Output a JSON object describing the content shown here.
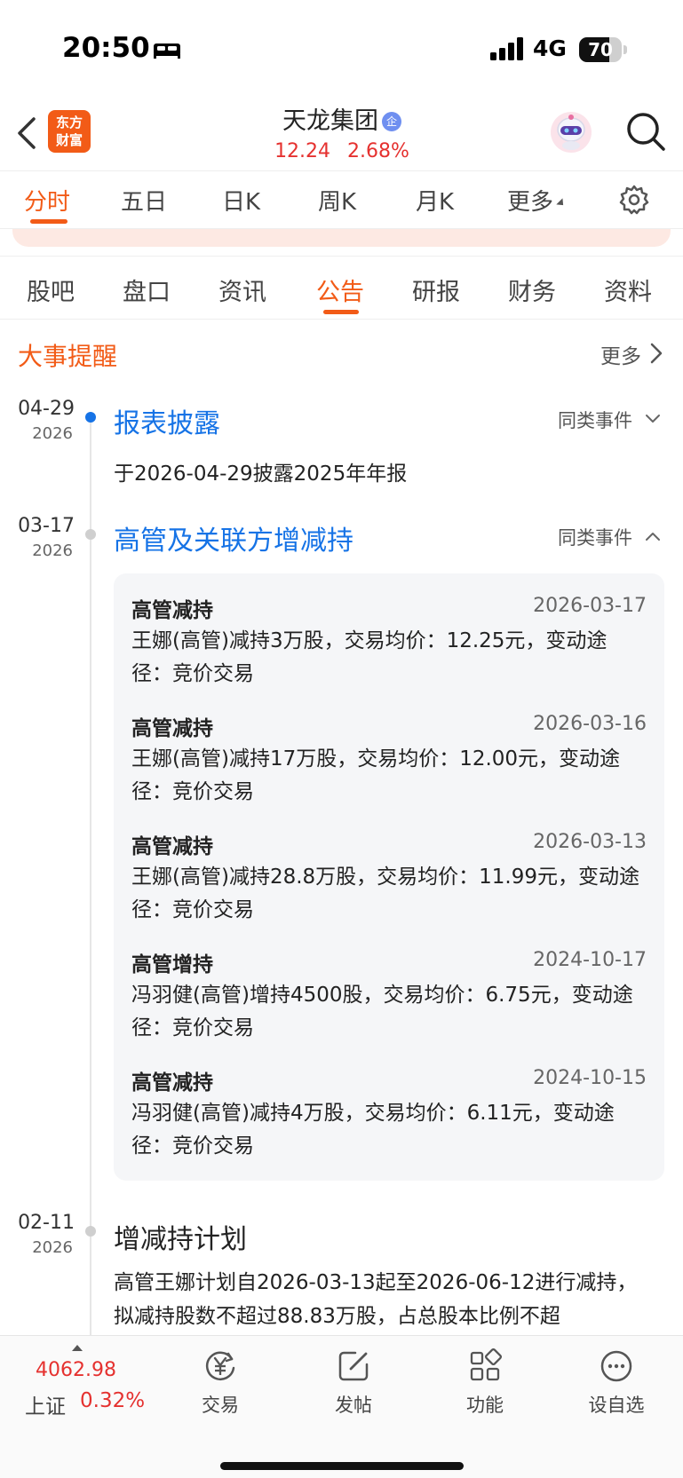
{
  "status_bar": {
    "time": "20:50",
    "network": "4G",
    "battery": "70",
    "battery_level": 0.7
  },
  "header": {
    "logo_text_line1": "东方",
    "logo_text_line2": "财富",
    "stock_name": "天龙集团",
    "badge": "企",
    "price": "12.24",
    "change_pct": "2.68%"
  },
  "chart_tabs": [
    {
      "label": "分时",
      "active": true
    },
    {
      "label": "五日"
    },
    {
      "label": "日K"
    },
    {
      "label": "周K"
    },
    {
      "label": "月K"
    },
    {
      "label": "更多"
    }
  ],
  "content_tabs": [
    {
      "label": "股吧"
    },
    {
      "label": "盘口"
    },
    {
      "label": "资讯"
    },
    {
      "label": "公告",
      "active": true
    },
    {
      "label": "研报"
    },
    {
      "label": "财务"
    },
    {
      "label": "资料"
    }
  ],
  "section": {
    "title": "大事提醒",
    "more": "更多"
  },
  "events": [
    {
      "date": "04-29",
      "year": "2026",
      "title": "报表披露",
      "similar": "同类事件",
      "text": "于2026-04-29披露2025年年报"
    },
    {
      "date": "03-17",
      "year": "2026",
      "title": "高管及关联方增减持",
      "similar": "同类事件",
      "items": [
        {
          "title": "高管减持",
          "date": "2026-03-17",
          "desc": "王娜(高管)减持3万股，交易均价：12.25元，变动途径：竞价交易"
        },
        {
          "title": "高管减持",
          "date": "2026-03-16",
          "desc": "王娜(高管)减持17万股，交易均价：12.00元，变动途径：竞价交易"
        },
        {
          "title": "高管减持",
          "date": "2026-03-13",
          "desc": "王娜(高管)减持28.8万股，交易均价：11.99元，变动途径：竞价交易"
        },
        {
          "title": "高管增持",
          "date": "2024-10-17",
          "desc": "冯羽健(高管)增持4500股，交易均价：6.75元，变动途径：竞价交易"
        },
        {
          "title": "高管减持",
          "date": "2024-10-15",
          "desc": "冯羽健(高管)减持4万股，交易均价：6.11元，变动途径：竞价交易"
        }
      ]
    },
    {
      "date": "02-11",
      "year": "2026",
      "title": "增减持计划",
      "text": "高管王娜计划自2026-03-13起至2026-06-12进行减持，拟减持股数不超过88.83万股，占总股本比例不超"
    }
  ],
  "bottom_bar": {
    "index_value": "4062.98",
    "index_name": "上证",
    "index_change": "0.32%",
    "items": [
      {
        "label": "交易",
        "icon": "trade-yen-icon"
      },
      {
        "label": "发帖",
        "icon": "compose-icon"
      },
      {
        "label": "功能",
        "icon": "grid-icon"
      },
      {
        "label": "设自选",
        "icon": "more-dots-icon"
      }
    ]
  },
  "colors": {
    "accent": "#f25b17",
    "up": "#e5312f",
    "link": "#1673e6"
  }
}
